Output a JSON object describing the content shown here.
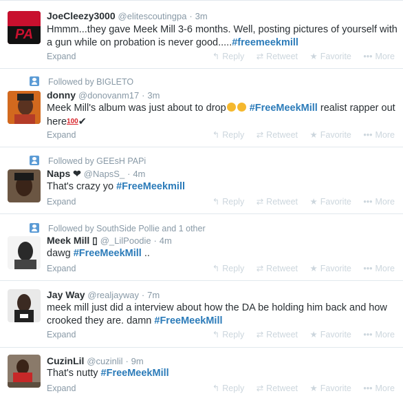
{
  "tweets": [
    {
      "context": "",
      "name": "JoeCleezy3000",
      "handle": "@elitescoutingpa",
      "time": "3m",
      "text": "Hmmm...they gave Meek Mill 3-6 months. Well, posting pictures of yourself with a gun while on probation is never good.....",
      "tag": "#freemeekmill",
      "avatar_label": "PA"
    },
    {
      "context": "Followed by BIGLETO",
      "name": "donny",
      "handle": "@donovanm17",
      "time": "3m",
      "text_before": "Meek Mill's album was just about to drop",
      "tag": "#FreeMeekMill",
      "text_after": " realist rapper out here",
      "badge": "100"
    },
    {
      "context": "Followed by GEEsH PAPi",
      "name": "Naps ❤",
      "handle": "@NapsS_",
      "time": "4m",
      "text": "That's crazy yo ",
      "tag": "#FreeMeekmill"
    },
    {
      "context": "Followed by SouthSide Pollie and 1 other",
      "name": "Meek Mill ▯",
      "handle": "@_LilPoodie",
      "time": "4m",
      "text": "dawg ",
      "tag": "#FreeMeekMill",
      "text_after": " .."
    },
    {
      "context": "",
      "name": "Jay Way",
      "handle": "@realjayway",
      "time": "7m",
      "text": "meek mill just did a interview about how the DA be holding him back and how crooked they are. damn ",
      "tag": "#FreeMeekMill"
    },
    {
      "context": "",
      "name": "CuzinLil",
      "handle": "@cuzinlil",
      "time": "9m",
      "text": "That's nutty ",
      "tag": "#FreeMeekMill"
    }
  ],
  "labels": {
    "expand": "Expand",
    "reply": "Reply",
    "retweet": "Retweet",
    "favorite": "Favorite",
    "more": "More",
    "dot": "·"
  },
  "icons": {
    "reply": "reply-arrow-icon",
    "retweet": "retweet-icon",
    "favorite": "star-icon",
    "more": "ellipsis-icon"
  },
  "colors": {
    "link": "#2b7bb9",
    "muted": "#8899a6",
    "actions": "#ccd6dd",
    "divider": "#e1e8ed"
  }
}
